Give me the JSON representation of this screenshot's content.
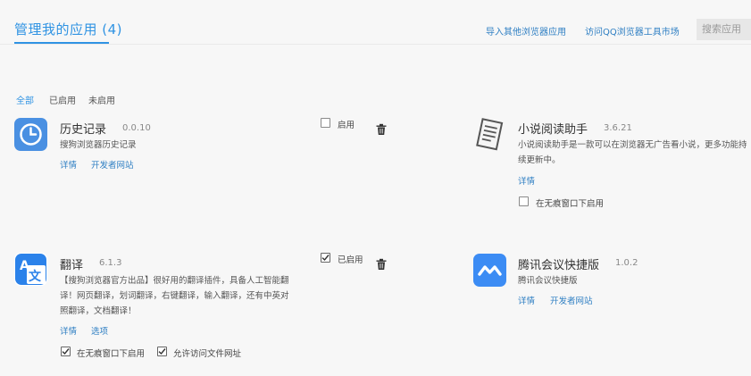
{
  "header": {
    "title": "管理我的应用 (4)",
    "import_link": "导入其他浏览器应用",
    "market_link": "访问QQ浏览器工具市场",
    "search_label": "搜索应用"
  },
  "filters": [
    {
      "label": "全部",
      "active": true
    },
    {
      "label": "已启用",
      "active": false
    },
    {
      "label": "未启用",
      "active": false
    }
  ],
  "apps": {
    "history": {
      "name": "历史记录",
      "version": "0.0.10",
      "description": "搜狗浏览器历史记录",
      "details": "详情",
      "developer": "开发者网站",
      "enable_label": "启用",
      "enabled": false,
      "icon": "clock-icon",
      "color": "#4a90e2"
    },
    "novel": {
      "name": "小说阅读助手",
      "version": "3.6.21",
      "description": "小说阅读助手是一款可以在浏览器无广告看小说，更多功能持续更新中。",
      "details": "详情",
      "incognito_label": "在无痕窗口下启用",
      "incognito": false,
      "icon": "document-icon"
    },
    "translate": {
      "name": "翻译",
      "version": "6.1.3",
      "description": "【搜狗浏览器官方出品】很好用的翻译插件，具备人工智能翻译！网页翻译，划词翻译，右键翻译，输入翻译，还有中英对照翻译，文档翻译！",
      "details": "详情",
      "options": "选项",
      "enable_label": "已启用",
      "enabled": true,
      "incognito_label": "在无痕窗口下启用",
      "incognito": true,
      "file_access_label": "允许访问文件网址",
      "file_access": true,
      "icon": "translate-icon",
      "color": "#2b82ea"
    },
    "meeting": {
      "name": "腾讯会议快捷版",
      "version": "1.0.2",
      "description": "腾讯会议快捷版",
      "details": "详情",
      "developer": "开发者网站",
      "icon": "meeting-icon",
      "color": "#3c8cf4"
    }
  }
}
